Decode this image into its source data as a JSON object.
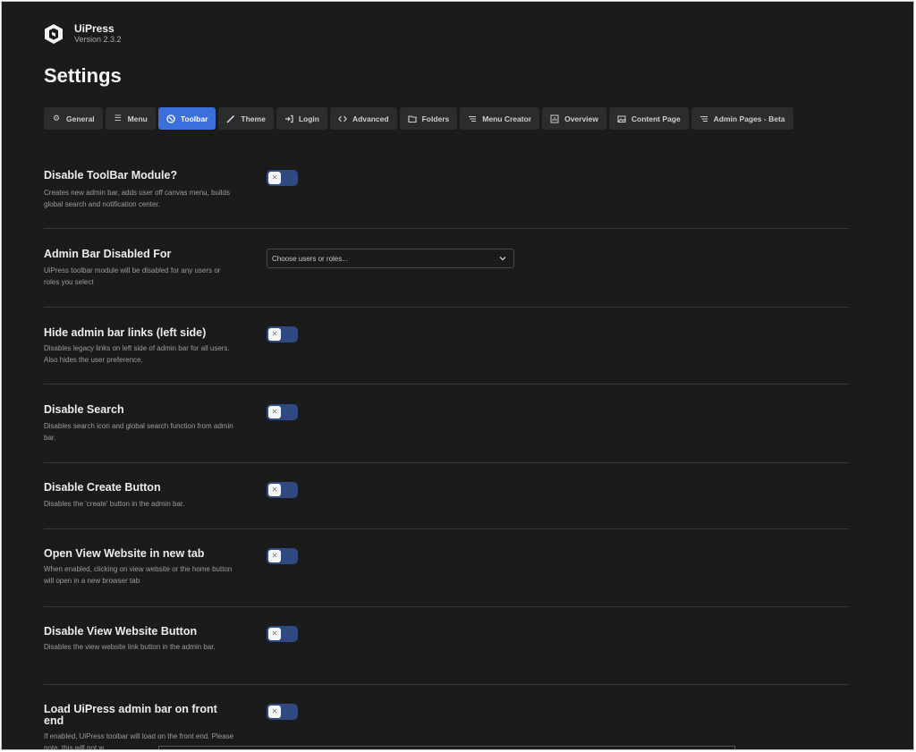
{
  "brand": {
    "name": "UiPress",
    "version": "Version 2.3.2"
  },
  "page_title": "Settings",
  "tabs": [
    {
      "label": "General",
      "icon": "gear-icon",
      "active": false
    },
    {
      "label": "Menu",
      "icon": "menu-icon",
      "active": false
    },
    {
      "label": "Toolbar",
      "icon": "toolbar-icon",
      "active": true
    },
    {
      "label": "Theme",
      "icon": "brush-icon",
      "active": false
    },
    {
      "label": "Login",
      "icon": "login-icon",
      "active": false
    },
    {
      "label": "Advanced",
      "icon": "code-icon",
      "active": false
    },
    {
      "label": "Folders",
      "icon": "folder-icon",
      "active": false
    },
    {
      "label": "Menu Creator",
      "icon": "list-icon",
      "active": false
    },
    {
      "label": "Overview",
      "icon": "chart-icon",
      "active": false
    },
    {
      "label": "Content Page",
      "icon": "image-icon",
      "active": false
    },
    {
      "label": "Admin Pages - Beta",
      "icon": "list-icon",
      "active": false
    }
  ],
  "settings": [
    {
      "title": "Disable ToolBar Module?",
      "desc": "Creates new admin bar, adds user off canvas menu, builds global search and notification center.",
      "control": "toggle",
      "value": false
    },
    {
      "title": "Admin Bar Disabled For",
      "desc": "UiPress toolbar module will be disabled for any users or roles you select",
      "control": "select",
      "placeholder": "Choose users or roles..."
    },
    {
      "title": "Hide admin bar links (left side)",
      "desc": "Disables legacy links on left side of admin bar for all users. Also hides the user preference.",
      "control": "toggle",
      "value": false
    },
    {
      "title": "Disable Search",
      "desc": "Disables search icon and global search function from admin bar.",
      "control": "toggle",
      "value": false
    },
    {
      "title": "Disable Create Button",
      "desc": "Disables the 'create' button in the admin bar.",
      "control": "toggle",
      "value": false
    },
    {
      "title": "Open View Website in new tab",
      "desc": "When enabled, clicking on view website or the home button will open in a new browser tab",
      "control": "toggle",
      "value": false
    },
    {
      "title": "Disable View Website Button",
      "desc": "Disables the view website link button in the admin bar.",
      "control": "toggle",
      "value": false
    },
    {
      "title": "Load UiPress admin bar on front end",
      "desc": "If enabled, UiPress toolbar will load on the front end. Please note, this will not w",
      "control": "toggle",
      "value": false
    }
  ]
}
